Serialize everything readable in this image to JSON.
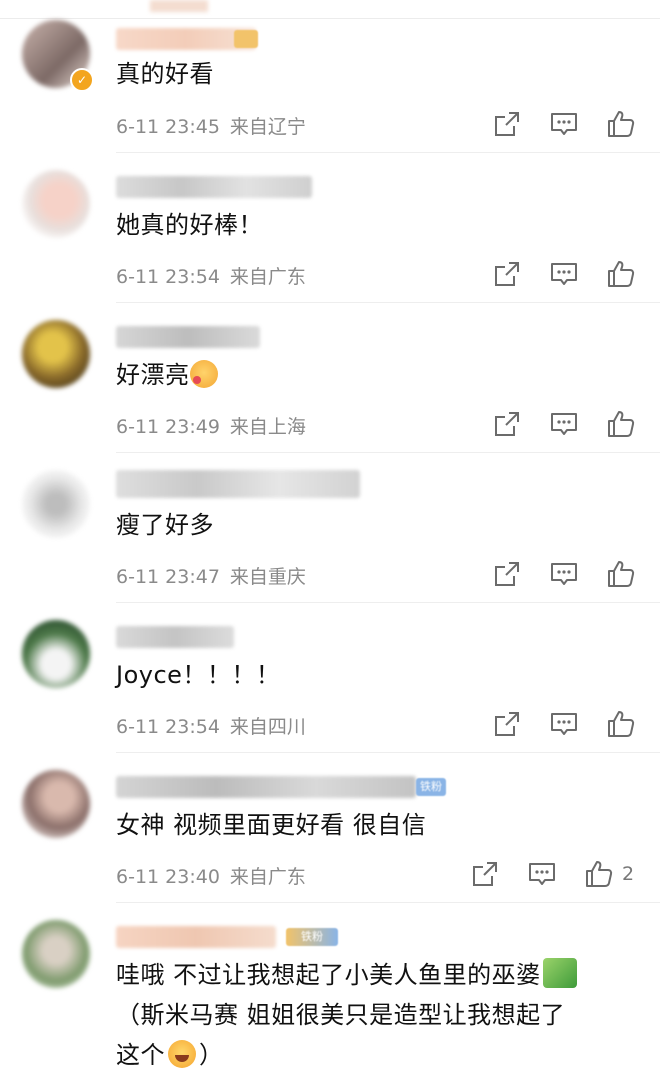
{
  "comments": [
    {
      "text": "真的好看",
      "date": "6-11 23:45",
      "location": "来自辽宁",
      "likes": ""
    },
    {
      "text": "她真的好棒！",
      "date": "6-11 23:54",
      "location": "来自广东",
      "likes": ""
    },
    {
      "text": "好漂亮",
      "date": "6-11 23:49",
      "location": "来自上海",
      "likes": ""
    },
    {
      "text": "瘦了好多",
      "date": "6-11 23:47",
      "location": "来自重庆",
      "likes": ""
    },
    {
      "text": "Joyce！！！！",
      "date": "6-11 23:54",
      "location": "来自四川",
      "likes": ""
    },
    {
      "text": "女神 视频里面更好看 很自信",
      "date": "6-11 23:40",
      "location": "来自广东",
      "likes": "2",
      "badge": "铁粉"
    },
    {
      "text_lines": [
        "哇哦 不过让我想起了小美人鱼里的巫婆",
        "（斯米马赛 姐姐很美只是造型让我想起了",
        "这个",
        "）"
      ],
      "badge": "铁粉"
    }
  ],
  "icons": {
    "share": "share-icon",
    "comment": "comment-icon",
    "like": "thumb-up-icon",
    "verified": "verified-badge-icon"
  },
  "colors": {
    "meta": "#8a8a8a",
    "icon": "#6b6b6b",
    "verified": "#f3a51f",
    "fan_badge": "#8ab4e6"
  }
}
